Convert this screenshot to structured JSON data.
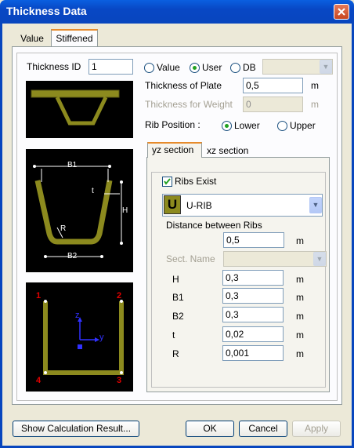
{
  "window": {
    "title": "Thickness Data"
  },
  "tabs": [
    {
      "label": "Value"
    },
    {
      "label": "Stiffened"
    }
  ],
  "thickness_id": {
    "label": "Thickness ID",
    "value": "1"
  },
  "source": {
    "options": [
      "Value",
      "User",
      "DB"
    ],
    "selected": "User"
  },
  "plate": {
    "label": "Thickness of Plate",
    "value": "0,5",
    "unit": "m"
  },
  "weight": {
    "label": "Thickness for Weight",
    "value": "0",
    "unit": "m"
  },
  "rib_position": {
    "label": "Rib Position :",
    "options": [
      "Lower",
      "Upper"
    ],
    "selected": "Lower"
  },
  "section_tabs": [
    {
      "label": "yz section"
    },
    {
      "label": "xz section"
    }
  ],
  "ribs_exist": {
    "label": "Ribs Exist",
    "checked": true
  },
  "rib_type": {
    "icon": "U",
    "value": "U-RIB"
  },
  "distance": {
    "label": "Distance between Ribs",
    "value": "0,5",
    "unit": "m"
  },
  "sect_name": {
    "label": "Sect. Name"
  },
  "dims": [
    {
      "label": "H",
      "value": "0,3",
      "unit": "m"
    },
    {
      "label": "B1",
      "value": "0,3",
      "unit": "m"
    },
    {
      "label": "B2",
      "value": "0,3",
      "unit": "m"
    },
    {
      "label": "t",
      "value": "0,02",
      "unit": "m"
    },
    {
      "label": "R",
      "value": "0,001",
      "unit": "m"
    }
  ],
  "diagram2": {
    "b1": "B1",
    "b2": "B2",
    "t": "t",
    "h": "H",
    "r": "R"
  },
  "diagram3": {
    "p1": "1",
    "p2": "2",
    "p3": "3",
    "p4": "4",
    "z": "z",
    "y": "y"
  },
  "buttons": {
    "show_calc": "Show Calculation Result...",
    "ok": "OK",
    "cancel": "Cancel",
    "apply": "Apply"
  },
  "colors": {
    "rib": "#8C8A1E",
    "accent_red": "#E00000",
    "axis_blue": "#3030FF"
  }
}
